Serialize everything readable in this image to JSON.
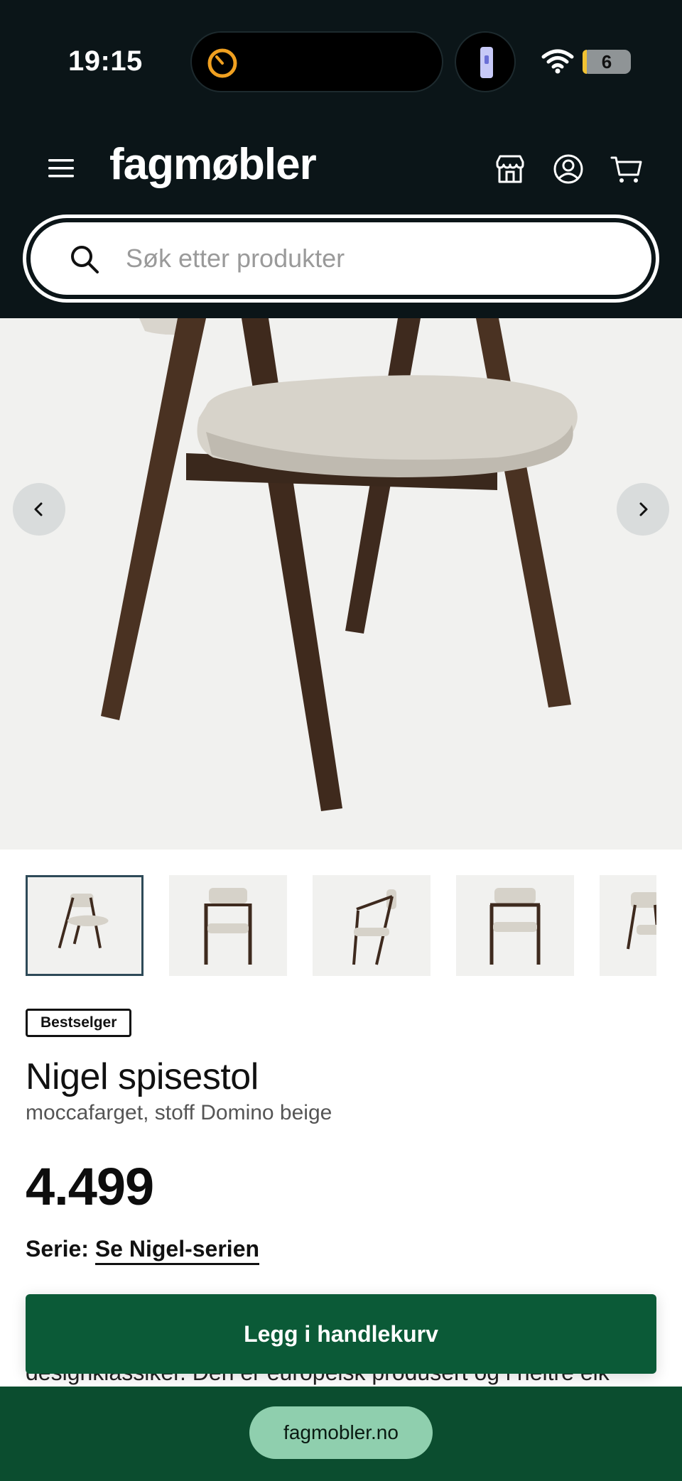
{
  "status_bar": {
    "time": "19:15",
    "battery_level": "6",
    "icons": [
      "timer-icon",
      "flashlight-icon",
      "wifi-icon",
      "battery-icon"
    ]
  },
  "header": {
    "logo": "fagmøbler",
    "icons": [
      "menu-icon",
      "store-icon",
      "account-icon",
      "cart-icon"
    ]
  },
  "search": {
    "placeholder": "Søk etter produkter",
    "value": ""
  },
  "gallery": {
    "prev_icon": "chevron-left-icon",
    "next_icon": "chevron-right-icon",
    "thumbnail_count": 5,
    "active_thumbnail": 1
  },
  "product": {
    "badge": "Bestselger",
    "title": "Nigel spisestol",
    "subtitle": "moccafarget, stoff Domino beige",
    "price": "4.499",
    "series_label": "Serie:",
    "series_link": "Se Nigel-serien",
    "description_partial": "designklassiker. Den er europeisk produsert og i heltre eik"
  },
  "actions": {
    "add_to_cart": "Legg i handlekurv"
  },
  "browser": {
    "url": "fagmobler.no"
  },
  "colors": {
    "header_bg": "#0b1518",
    "primary_green": "#0b5a37",
    "bottom_bar": "#0b4d2f",
    "url_pill": "#8fcfae",
    "gallery_bg": "#f1f1ef"
  }
}
